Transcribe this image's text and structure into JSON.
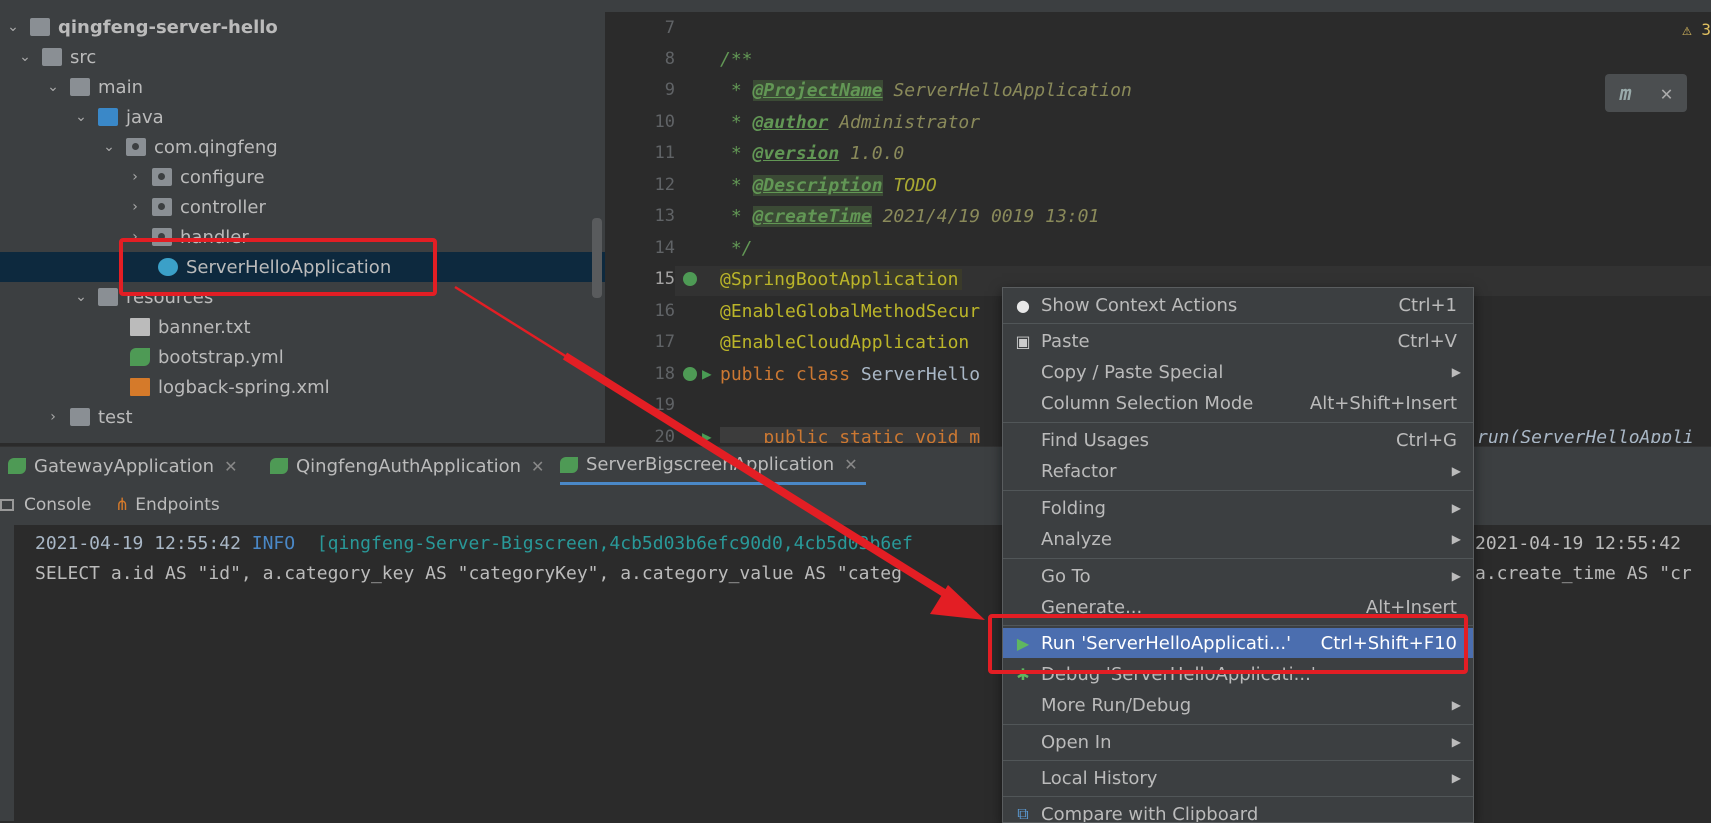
{
  "tree": {
    "root": "qingfeng-server-hello",
    "src": "src",
    "main": "main",
    "java": "java",
    "package": "com.qingfeng",
    "configure": "configure",
    "controller": "controller",
    "handler": "handler",
    "app_class": "ServerHelloApplication",
    "resources": "resources",
    "banner": "banner.txt",
    "bootstrap": "bootstrap.yml",
    "logback": "logback-spring.xml",
    "test": "test"
  },
  "editor": {
    "warning_count": "3",
    "lines": {
      "n7": "7",
      "n8": "8",
      "n9": "9",
      "n10": "10",
      "n11": "11",
      "n12": "12",
      "n13": "13",
      "n14": "14",
      "n15": "15",
      "n16": "16",
      "n17": "17",
      "n18": "18",
      "n19": "19",
      "n20": "20"
    },
    "doc_open": "/**",
    "doc_star": " * ",
    "tag_project": "@ProjectName",
    "val_project": " ServerHelloApplication",
    "tag_author": "@author",
    "val_author": " Administrator",
    "tag_version": "@version",
    "val_version": " 1.0.0",
    "tag_description": "@Description",
    "val_description": " TODO",
    "tag_create": "@createTime",
    "val_create": " 2021/4/19 0019 13:01",
    "doc_close": " */",
    "ann1": "@SpringBootApplication",
    "ann2": "@EnableGlobalMethodSecur",
    "ann3": "@EnableCloudApplication",
    "kw_public": "public",
    "kw_class": "class",
    "class_name": "ServerHello",
    "line20_left": "    public static void m",
    "line20_right": "run(ServerHelloAppli"
  },
  "run_tabs": [
    {
      "label": "GatewayApplication"
    },
    {
      "label": "QingfengAuthApplication"
    },
    {
      "label": "ServerBigscreenApplication"
    }
  ],
  "console_tabs": {
    "console": "Console",
    "endpoints": "Endpoints"
  },
  "console": {
    "line1_date": "2021-04-19 12:55:42",
    "line1_level": "INFO",
    "line1_thread": "[qingfeng-Server-Bigscreen,4cb5d03b6efc90d0,4cb5d03b6ef",
    "line1_right": "2021-04-19 12:55:42 ",
    "line2_left": "SELECT a.id AS \"id\", a.category_key AS \"categoryKey\", a.category_value AS \"categ",
    "line2_right": "a.create_time AS \"cr"
  },
  "context_menu": {
    "items": [
      {
        "label": "Show Context Actions",
        "shortcut": "Ctrl+1",
        "icon": "lightbulb-icon"
      },
      {
        "label": "Paste",
        "shortcut": "Ctrl+V",
        "icon": "clipboard-icon"
      },
      {
        "label": "Copy / Paste Special",
        "shortcut": "",
        "submenu": true
      },
      {
        "label": "Column Selection Mode",
        "shortcut": "Alt+Shift+Insert"
      },
      {
        "label": "Find Usages",
        "shortcut": "Ctrl+G"
      },
      {
        "label": "Refactor",
        "shortcut": "",
        "submenu": true
      },
      {
        "label": "Folding",
        "shortcut": "",
        "submenu": true
      },
      {
        "label": "Analyze",
        "shortcut": "",
        "submenu": true
      },
      {
        "label": "Go To",
        "shortcut": "",
        "submenu": true
      },
      {
        "label": "Generate...",
        "shortcut": "Alt+Insert"
      },
      {
        "label": "Run 'ServerHelloApplicati...'",
        "shortcut": "Ctrl+Shift+F10",
        "icon": "run-icon"
      },
      {
        "label": "Debug 'ServerHelloApplicati...'",
        "shortcut": "",
        "icon": "debug-icon"
      },
      {
        "label": "More Run/Debug",
        "shortcut": "",
        "submenu": true
      },
      {
        "label": "Open In",
        "shortcut": "",
        "submenu": true
      },
      {
        "label": "Local History",
        "shortcut": "",
        "submenu": true
      },
      {
        "label": "Compare with Clipboard",
        "shortcut": "",
        "icon": "compare-icon"
      }
    ]
  },
  "colors": {
    "annotation_red": "#e31e24",
    "menu_highlight": "#4b6eaf",
    "run_green": "#499c54"
  }
}
